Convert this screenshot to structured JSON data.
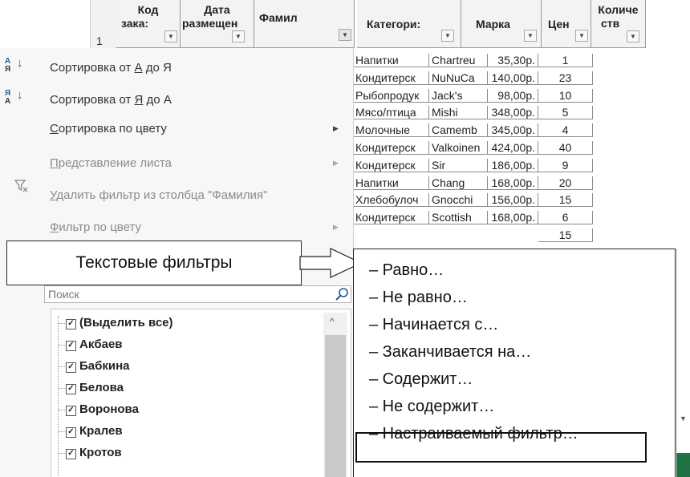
{
  "header": {
    "row_number": "1",
    "columns": [
      {
        "label": "Код зака:",
        "line1": "Код",
        "line2": "зака:"
      },
      {
        "label": "Дата размещен",
        "line1": "Дата",
        "line2": "размещен"
      },
      {
        "label": "Фамил"
      },
      {
        "label": "Категори:"
      },
      {
        "label": "Марка"
      },
      {
        "label": "Цен"
      },
      {
        "label": "Количе ств",
        "line1": "Количе",
        "line2": "ств"
      }
    ]
  },
  "table": {
    "rows": [
      [
        "Напитки",
        "Chartreu",
        "35,30р.",
        "1"
      ],
      [
        "Кондитерск",
        "NuNuCa",
        "140,00р.",
        "23"
      ],
      [
        "Рыбопродук",
        "Jack's",
        "98,00р.",
        "10"
      ],
      [
        "Мясо/птица",
        "Mishi",
        "348,00р.",
        "5"
      ],
      [
        "Молочные",
        "Camemb",
        "345,00р.",
        "4"
      ],
      [
        "Кондитерск",
        "Valkoinen",
        "424,00р.",
        "40"
      ],
      [
        "Кондитерск",
        "Sir",
        "186,00р.",
        "9"
      ],
      [
        "Напитки",
        "Chang",
        "168,00р.",
        "20"
      ],
      [
        "Хлебобулоч",
        "Gnocchi",
        "156,00р.",
        "15"
      ],
      [
        "Кондитерск",
        "Scottish",
        "168,00р.",
        "6"
      ]
    ],
    "partial_row_qty": "15"
  },
  "menu": {
    "sort_asc": {
      "prefix": "Сортировка от ",
      "u": "А",
      "mid": " до Я"
    },
    "sort_desc": {
      "prefix": "Сортировка от ",
      "u": "Я",
      "mid": " до А"
    },
    "sort_color": {
      "u": "С",
      "rest": "ортировка по цвету"
    },
    "sheet_view": {
      "u": "П",
      "rest": "редставление листа"
    },
    "clear_filter": {
      "u": "У",
      "rest": "далить фильтр из столбца \"Фамилия\""
    },
    "color_filter": {
      "u": "Ф",
      "rest": "ильтр по цвету"
    }
  },
  "search": {
    "placeholder": "Поиск"
  },
  "list": {
    "items": [
      "(Выделить все)",
      "Акбаев",
      "Бабкина",
      "Белова",
      "Воронова",
      "Кралев",
      "Кротов"
    ]
  },
  "callout": {
    "label": "Текстовые фильтры"
  },
  "submenu": {
    "items": [
      "– Равно…",
      "– Не равно…",
      "– Начинается с…",
      "– Заканчивается на…",
      "– Содержит…",
      "– Не содержит…",
      "– Настраиваемый фильтр…"
    ]
  },
  "colors": {
    "accent_green": "#217346",
    "menu_bg": "#f7f7f7"
  },
  "icons": [
    "sort-az-icon",
    "sort-za-icon",
    "clear-filter-icon",
    "search-icon",
    "dropdown-arrow-icon",
    "submenu-arrow-icon",
    "scroll-up-icon"
  ]
}
